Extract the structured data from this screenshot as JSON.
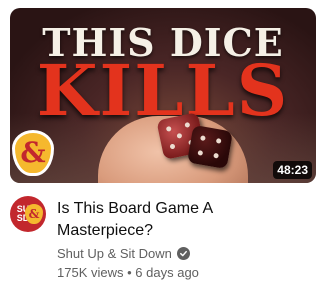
{
  "video": {
    "thumbnail": {
      "title_line_1": "THIS DICE",
      "title_line_2": "KILLS",
      "duration": "48:23",
      "logo_text": "&"
    },
    "channel_avatar": {
      "text_top": "SU",
      "text_bottom": "SD",
      "amp": "&"
    },
    "title": "Is This Board Game A Masterpiece?",
    "channel": "Shut Up & Sit Down",
    "views": "175K views",
    "separator": "•",
    "age": "6 days ago"
  },
  "colors": {
    "title_red": "#e3331d",
    "brand_red": "#c2272d",
    "brand_yellow": "#f5b82e",
    "text_primary": "#0f0f0f",
    "text_secondary": "#606060"
  },
  "icons": {
    "verified": "check-circle-icon",
    "more": "vertical-dots-icon"
  }
}
